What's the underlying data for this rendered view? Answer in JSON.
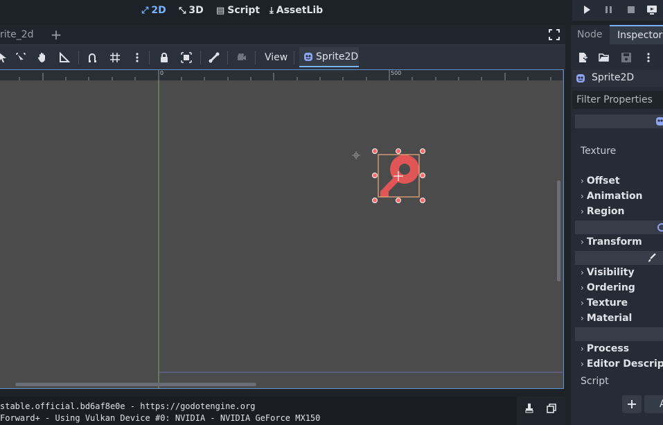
{
  "main_modes": [
    {
      "label": "2D",
      "active": true,
      "icon": "2d-icon"
    },
    {
      "label": "3D",
      "active": false,
      "icon": "3d-icon"
    },
    {
      "label": "Script",
      "active": false,
      "icon": "script-icon"
    },
    {
      "label": "AssetLib",
      "active": false,
      "icon": "assetlib-icon"
    }
  ],
  "scene_tab": {
    "label": "rite_2d"
  },
  "toolbar": {
    "view_label": "View",
    "selected_node_label": "Sprite2D"
  },
  "ruler": {
    "zero_label": "0",
    "five_hundred_label": "500"
  },
  "output": {
    "line1": "stable.official.bd6af8e0e - https://godotengine.org",
    "line2": "Forward+ - Using Vulkan Device #0: NVIDIA - NVIDIA GeForce MX150"
  },
  "dock": {
    "tabs": [
      {
        "label": "Node",
        "active": false
      },
      {
        "label": "Inspector",
        "active": true
      }
    ],
    "node_name": "Sprite2D",
    "filter_placeholder": "Filter Properties",
    "texture_label": "Texture",
    "sections": [
      "Offset",
      "Animation",
      "Region",
      "Transform",
      "Visibility",
      "Ordering",
      "Texture",
      "Material",
      "Process",
      "Editor Descriptio"
    ],
    "script_label": "Script",
    "add_label": "A"
  },
  "colors": {
    "accent": "#77b4ff",
    "viewport": "#4b4b4b",
    "selection": "#ff6b6b",
    "sprite": "#e05656"
  }
}
